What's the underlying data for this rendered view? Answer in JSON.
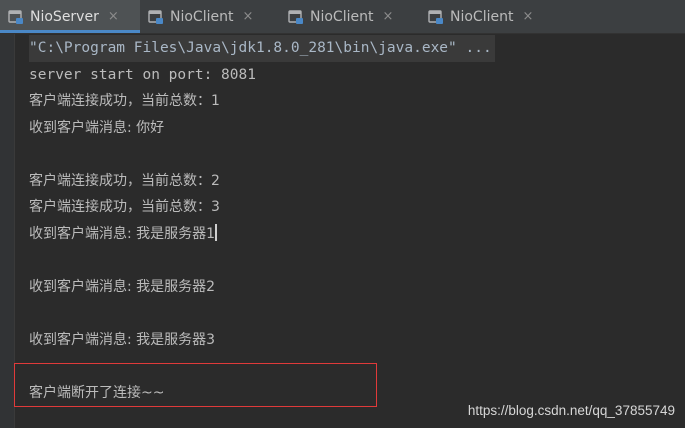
{
  "tabs": [
    {
      "label": "NioServer",
      "active": true
    },
    {
      "label": "NioClient",
      "active": false
    },
    {
      "label": "NioClient",
      "active": false
    },
    {
      "label": "NioClient",
      "active": false
    }
  ],
  "tab_close_glyph": "×",
  "console": {
    "command": "\"C:\\Program Files\\Java\\jdk1.8.0_281\\bin\\java.exe\" ...",
    "lines": [
      "server start on port: 8081",
      "客户端连接成功，当前总数：1",
      "收到客户端消息: 你好",
      "",
      "客户端连接成功，当前总数：2",
      "客户端连接成功，当前总数：3",
      "收到客户端消息: 我是服务器1",
      "",
      "收到客户端消息: 我是服务器2",
      "",
      "收到客户端消息: 我是服务器3",
      "",
      "客户端断开了连接~~"
    ]
  },
  "watermark": "https://blog.csdn.net/qq_37855749",
  "colors": {
    "background": "#2b2b2b",
    "tab_active_underline": "#4a88c7",
    "highlight_border": "#e03a3a"
  }
}
